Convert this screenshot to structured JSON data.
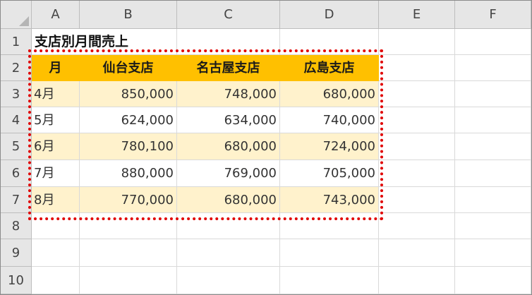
{
  "columns": [
    "A",
    "B",
    "C",
    "D",
    "E",
    "F"
  ],
  "rows": [
    "1",
    "2",
    "3",
    "4",
    "5",
    "6",
    "7",
    "8",
    "9",
    "10"
  ],
  "title": "支店別月間売上",
  "table": {
    "headers": [
      "月",
      "仙台支店",
      "名古屋支店",
      "広島支店"
    ],
    "rows": [
      [
        "4月",
        "850,000",
        "748,000",
        "680,000"
      ],
      [
        "5月",
        "624,000",
        "634,000",
        "740,000"
      ],
      [
        "6月",
        "780,100",
        "680,000",
        "724,000"
      ],
      [
        "7月",
        "880,000",
        "769,000",
        "705,000"
      ],
      [
        "8月",
        "770,000",
        "680,000",
        "743,000"
      ]
    ]
  },
  "colors": {
    "header_fill": "#ffc000",
    "band_fill": "#fff2cc",
    "selection_border": "#e00000"
  }
}
